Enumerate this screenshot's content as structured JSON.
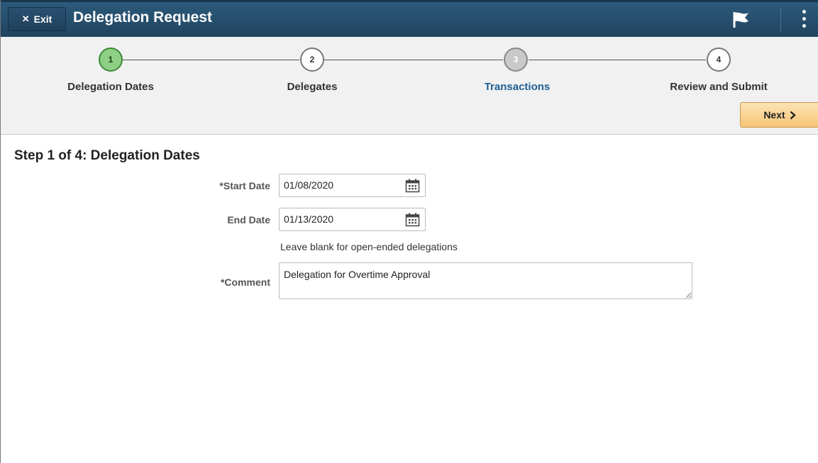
{
  "header": {
    "exit_label": "Exit",
    "title": "Delegation Request",
    "flag_icon": "flag-icon",
    "actions_icon": "kebab-menu-icon"
  },
  "steps": [
    {
      "number": "1",
      "label": "Delegation Dates",
      "state": "active"
    },
    {
      "number": "2",
      "label": "Delegates",
      "state": "default"
    },
    {
      "number": "3",
      "label": "Transactions",
      "state": "visited"
    },
    {
      "number": "4",
      "label": "Review and Submit",
      "state": "default"
    }
  ],
  "next_label": "Next",
  "form": {
    "heading": "Step 1 of 4: Delegation Dates",
    "start_date_label": "*Start Date",
    "start_date_value": "01/08/2020",
    "end_date_label": "End Date",
    "end_date_value": "01/13/2020",
    "hint": "Leave blank for open-ended delegations",
    "comment_label": "*Comment",
    "comment_value": "Delegation for Overtime Approval"
  },
  "colors": {
    "header": "#2c5a7b",
    "active_step": "#8ecf86",
    "link": "#1f5f94",
    "next_button": "#f7c677"
  }
}
